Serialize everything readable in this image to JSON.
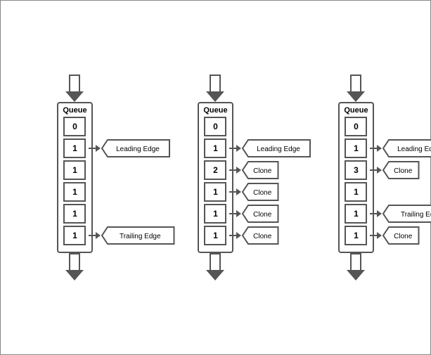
{
  "diagrams": [
    {
      "id": "diagram1",
      "cells": [
        {
          "value": "0",
          "label": null
        },
        {
          "value": "1",
          "label": "Leading Edge"
        },
        {
          "value": "1",
          "label": null
        },
        {
          "value": "1",
          "label": null
        },
        {
          "value": "1",
          "label": null
        },
        {
          "value": "1",
          "label": "Trailing Edge"
        }
      ]
    },
    {
      "id": "diagram2",
      "cells": [
        {
          "value": "0",
          "label": null
        },
        {
          "value": "1",
          "label": "Leading Edge"
        },
        {
          "value": "2",
          "label": "Clone"
        },
        {
          "value": "1",
          "label": "Clone"
        },
        {
          "value": "1",
          "label": "Clone"
        },
        {
          "value": "1",
          "label": "Clone"
        }
      ]
    },
    {
      "id": "diagram3",
      "cells": [
        {
          "value": "0",
          "label": null
        },
        {
          "value": "1",
          "label": "Leading Edge"
        },
        {
          "value": "3",
          "label": "Clone"
        },
        {
          "value": "1",
          "label": null
        },
        {
          "value": "1",
          "label": "Trailing Edge"
        },
        {
          "value": "1",
          "label": "Clone"
        }
      ]
    }
  ],
  "queue_label": "Queue"
}
